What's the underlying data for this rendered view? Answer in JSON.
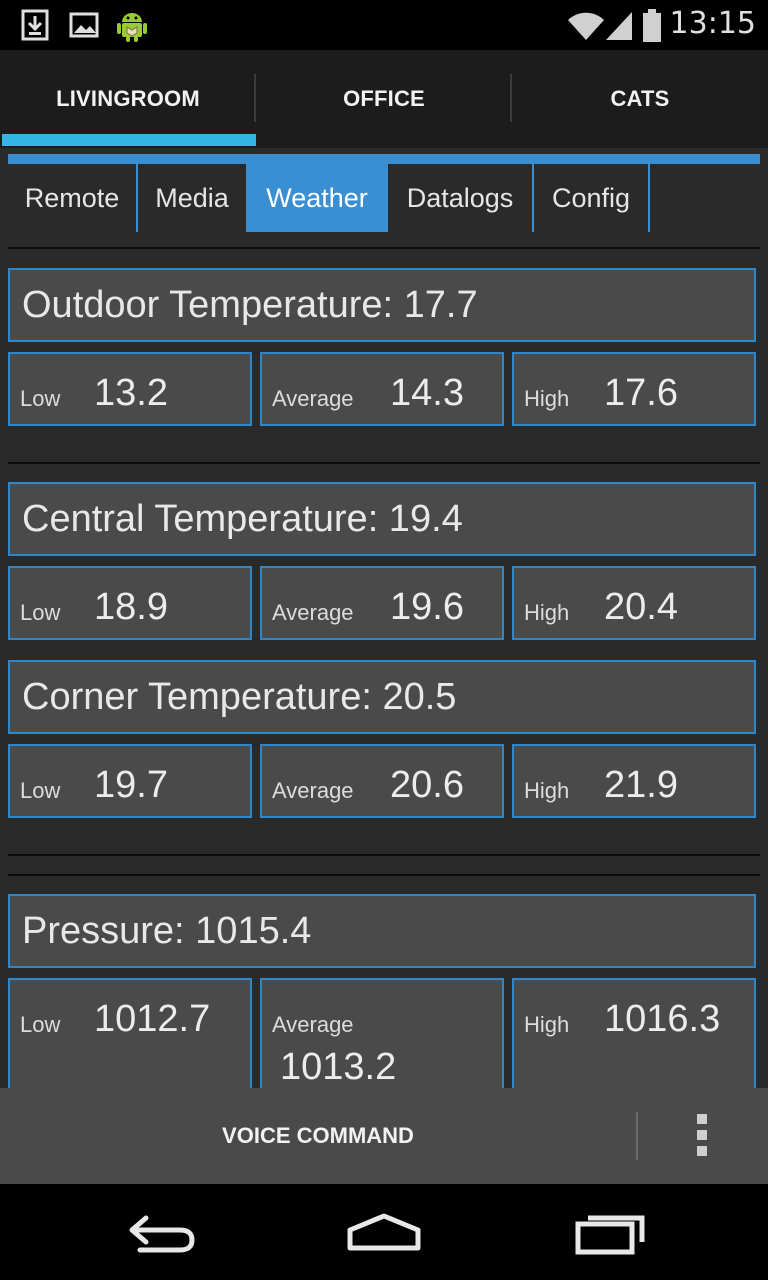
{
  "status_bar": {
    "time": "13:15",
    "icons": [
      "download-icon",
      "image-icon",
      "android-icon",
      "wifi-icon",
      "signal-icon",
      "battery-icon"
    ]
  },
  "top_tabs": {
    "items": [
      {
        "label": "LIVINGROOM",
        "selected": true
      },
      {
        "label": "OFFICE",
        "selected": false
      },
      {
        "label": "CATS",
        "selected": false
      }
    ]
  },
  "sub_tabs": {
    "items": [
      {
        "label": "Remote",
        "selected": false
      },
      {
        "label": "Media",
        "selected": false
      },
      {
        "label": "Weather",
        "selected": true
      },
      {
        "label": "Datalogs",
        "selected": false
      },
      {
        "label": "Config",
        "selected": false
      }
    ]
  },
  "sections": {
    "outdoor": {
      "title": "Outdoor Temperature: 17.7",
      "low_label": "Low",
      "low_value": "13.2",
      "avg_label": "Average",
      "avg_value": "14.3",
      "high_label": "High",
      "high_value": "17.6"
    },
    "central": {
      "title": "Central Temperature: 19.4",
      "low_label": "Low",
      "low_value": "18.9",
      "avg_label": "Average",
      "avg_value": "19.6",
      "high_label": "High",
      "high_value": "20.4"
    },
    "corner": {
      "title": "Corner Temperature: 20.5",
      "low_label": "Low",
      "low_value": "19.7",
      "avg_label": "Average",
      "avg_value": "20.6",
      "high_label": "High",
      "high_value": "21.9"
    },
    "pressure": {
      "title": "Pressure: 1015.4",
      "low_label": "Low",
      "low_value": "1012.7",
      "avg_label": "Average",
      "avg_value": "1013.2",
      "high_label": "High",
      "high_value": "1016.3"
    }
  },
  "action_bar": {
    "voice_label": "VOICE COMMAND",
    "overflow_icon": "more-vert-icon"
  },
  "nav_bar": {
    "icons": [
      "back-icon",
      "home-icon",
      "recents-icon"
    ]
  },
  "colors": {
    "accent": "#33b5e5",
    "tab_blue": "#3a8fd3",
    "card_bg": "#4a4a4a",
    "card_border": "#2f86c8"
  }
}
